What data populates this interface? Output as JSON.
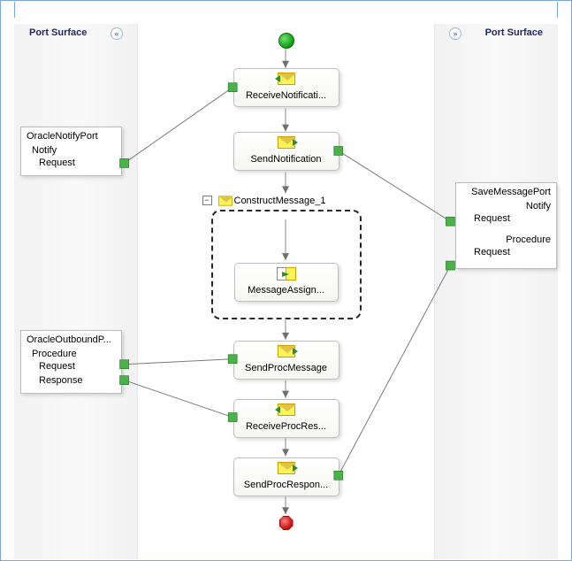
{
  "headers": {
    "left_title": "Port Surface",
    "right_title": "Port Surface",
    "left_chevron": "«",
    "right_chevron": "»"
  },
  "ports": {
    "oracleNotify": {
      "title": "OracleNotifyPort",
      "op1": "Notify",
      "msg1": "Request"
    },
    "oracleOutbound": {
      "title": "OracleOutboundP...",
      "op1": "Procedure",
      "msg1": "Request",
      "msg2": "Response"
    },
    "saveMessage": {
      "title": "SaveMessagePort",
      "op1": "Notify",
      "msg1": "Request",
      "op2": "Procedure",
      "msg2": "Request"
    }
  },
  "shapes": {
    "receiveNotification": "ReceiveNotificati...",
    "sendNotification": "SendNotification",
    "constructMessage": "ConstructMessage_1",
    "messageAssign": "MessageAssign...",
    "sendProcMessage": "SendProcMessage",
    "receiveProcRes": "ReceiveProcRes...",
    "sendProcResponse": "SendProcRespon...",
    "collapseToggle": "−"
  }
}
